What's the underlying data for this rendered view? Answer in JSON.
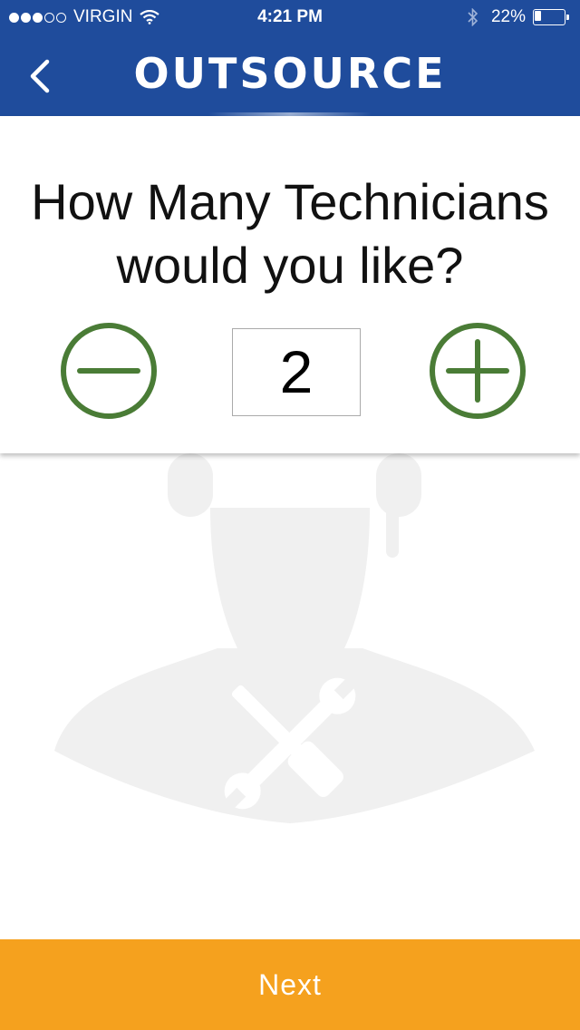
{
  "status_bar": {
    "carrier": "VIRGIN",
    "time": "4:21 PM",
    "battery_percent_text": "22%",
    "battery_level": 0.22,
    "signal_bars_filled": 3,
    "signal_bars_total": 5
  },
  "header": {
    "logo_text": "OUTSOURCE",
    "back_icon": "chevron-left-icon"
  },
  "question": {
    "title": "How Many Technicians would you like?"
  },
  "stepper": {
    "value": "2",
    "decrement_icon": "minus-circle-icon",
    "increment_icon": "plus-circle-icon"
  },
  "footer": {
    "next_label": "Next"
  },
  "colors": {
    "header_bg": "#1f4c9c",
    "accent_green": "#4a7c36",
    "next_bg": "#f5a11e",
    "watermark": "#f0f0f0"
  }
}
